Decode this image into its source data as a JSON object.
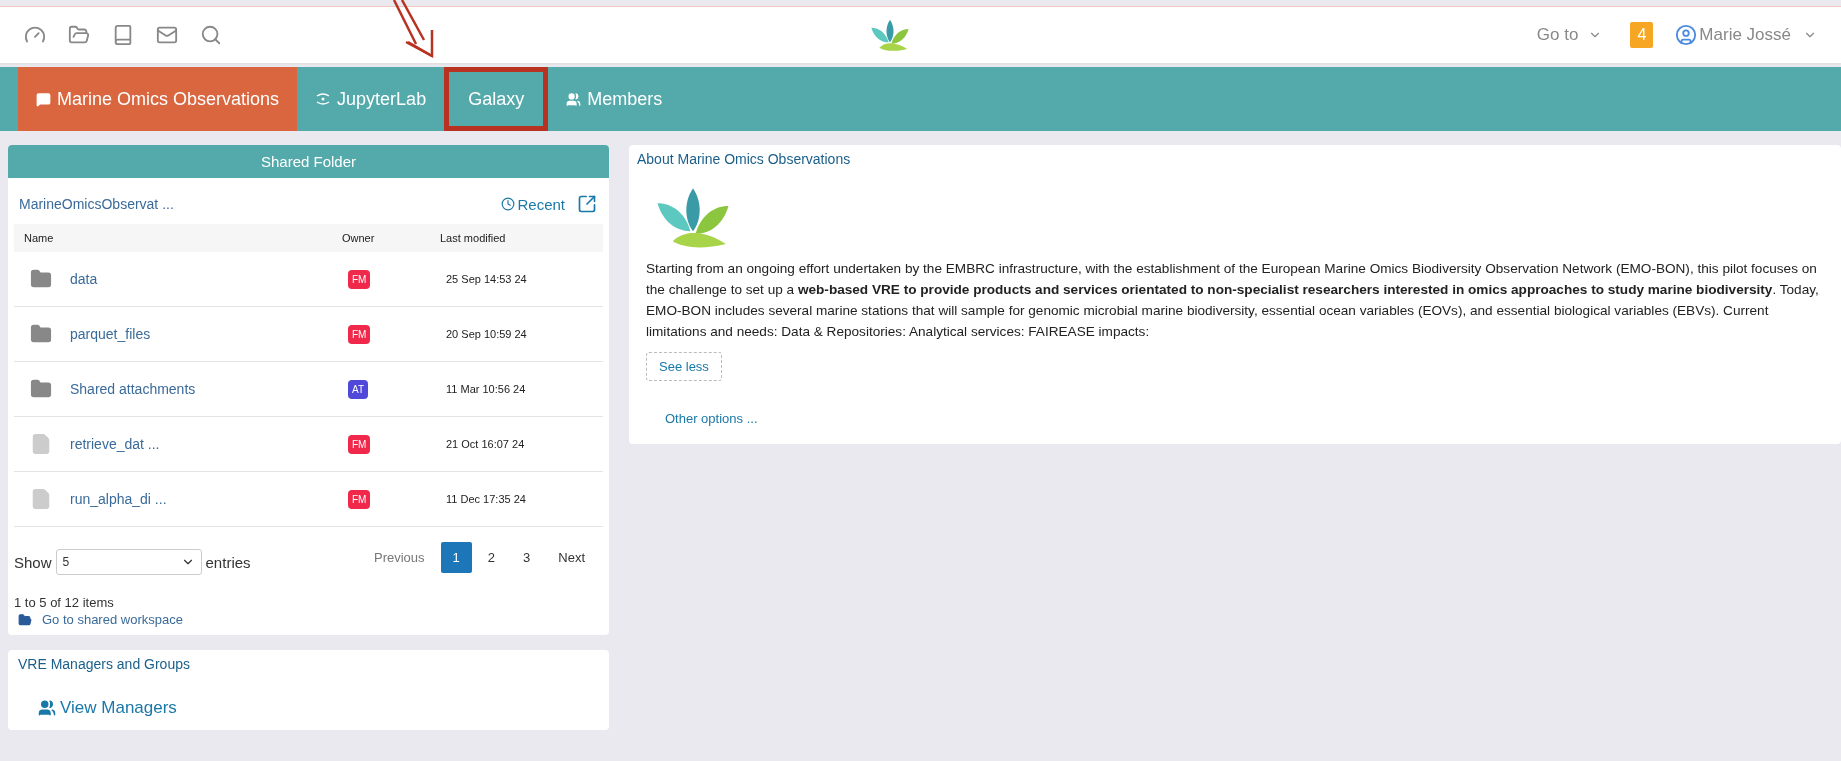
{
  "top_bar": {
    "goto": "Go to",
    "notifications": "4",
    "user": "Marie Jossé"
  },
  "nav_tabs": [
    {
      "label": "Marine Omics Observations",
      "kind": "chat",
      "selected": true,
      "highlighted": false
    },
    {
      "label": "JupyterLab",
      "kind": "jupyter",
      "selected": false,
      "highlighted": false
    },
    {
      "label": "Galaxy",
      "kind": "plain",
      "selected": false,
      "highlighted": true
    },
    {
      "label": "Members",
      "kind": "people",
      "selected": false,
      "highlighted": false
    }
  ],
  "shared_folder": {
    "title": "Shared Folder",
    "path": "MarineOmicsObservat ...",
    "recent": "Recent",
    "columns": [
      "Name",
      "Owner",
      "Last modified"
    ],
    "rows": [
      {
        "name": "data",
        "kind": "folder",
        "owner": "FM",
        "color": "#f0284a",
        "modified": "25 Sep 14:53 24"
      },
      {
        "name": "parquet_files",
        "kind": "folder",
        "owner": "FM",
        "color": "#f0284a",
        "modified": "20 Sep 10:59 24"
      },
      {
        "name": "Shared attachments",
        "kind": "folder",
        "owner": "AT",
        "color": "#5048d8",
        "modified": "11 Mar 10:56 24"
      },
      {
        "name": "retrieve_dat ...",
        "kind": "file",
        "owner": "FM",
        "color": "#f0284a",
        "modified": "21 Oct 16:07 24"
      },
      {
        "name": "run_alpha_di ...",
        "kind": "file",
        "owner": "FM",
        "color": "#f0284a",
        "modified": "11 Dec 17:35 24"
      }
    ],
    "show_label": "Show",
    "show_value": "5",
    "entries_label": "entries",
    "pagination": {
      "previous": "Previous",
      "pages": [
        {
          "label": "1",
          "selected": true
        },
        {
          "label": "2",
          "selected": false
        },
        {
          "label": "3",
          "selected": false
        }
      ],
      "next": "Next"
    },
    "summary": "1 to 5 of 12 items",
    "workspace_link": "Go to shared workspace"
  },
  "managers": {
    "title": "VRE Managers and Groups",
    "link": "View Managers"
  },
  "about": {
    "title": "About Marine Omics Observations",
    "text": "Starting from an ongoing effort undertaken by the EMBRC infrastructure, with the establishment of the European Marine Omics Biodiversity Observation Network (EMO-BON), this pilot focuses on the challenge to set up a **web-based VRE to provide products and services orientated to non-specialist researchers interested in omics approaches to study marine biodiversity**. Today, EMO-BON includes several marine stations that will sample for genomic microbial marine biodiversity, essential ocean variables (EOVs), and essential biological variables (EBVs). Current limitations and needs: Data & Repositories: Analytical services: FAIREASE impacts:",
    "button": "See less",
    "link": "Other options ..."
  }
}
